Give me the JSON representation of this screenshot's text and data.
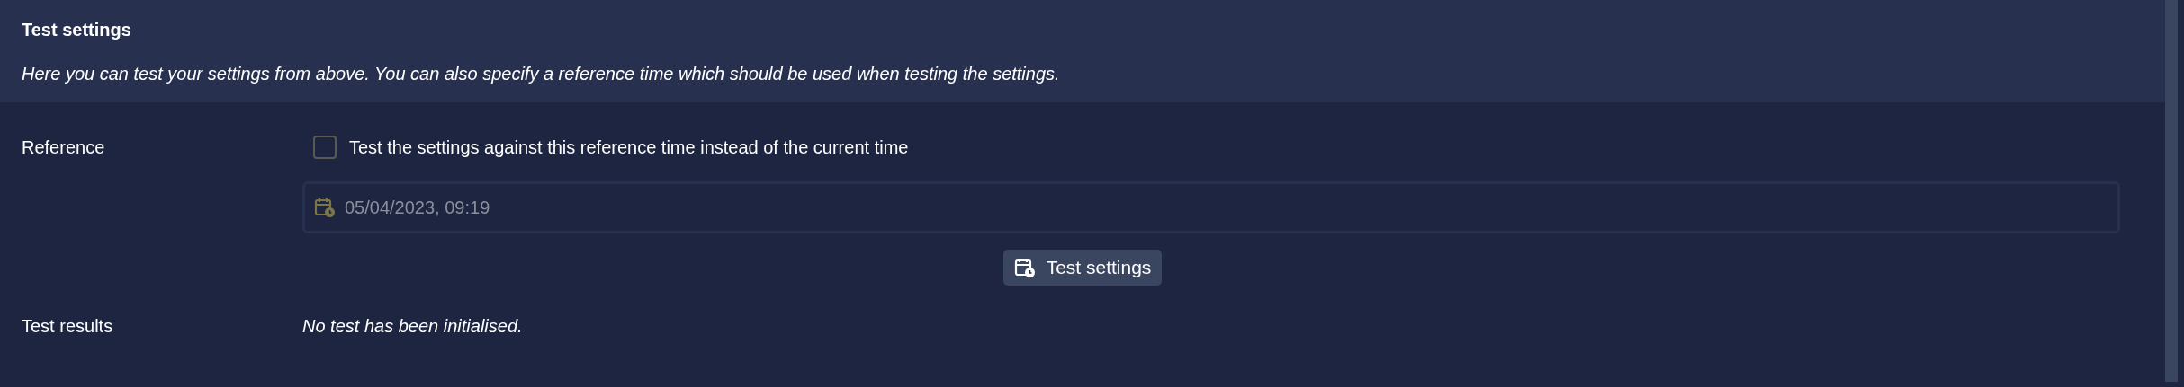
{
  "header": {
    "title": "Test settings",
    "description": "Here you can test your settings from above. You can also specify a reference time which should be used when testing the settings."
  },
  "reference": {
    "label": "Reference",
    "checkbox": {
      "label": "Test the settings against this reference time instead of the current time",
      "checked": false
    },
    "date_field": {
      "value": "05/04/2023, 09:19",
      "disabled": true
    }
  },
  "test_button": {
    "label": "Test settings"
  },
  "results": {
    "label": "Test results",
    "message": "No test has been initialised."
  }
}
